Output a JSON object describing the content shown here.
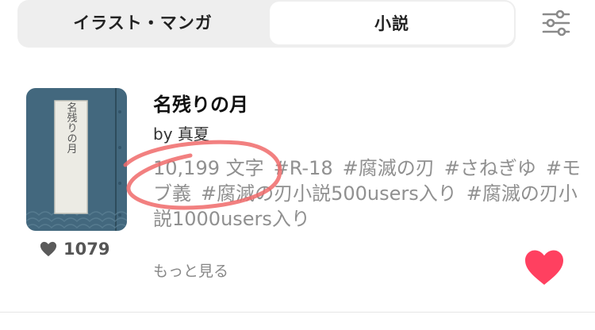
{
  "tabs": [
    {
      "label": "イラスト・マンガ",
      "selected": false
    },
    {
      "label": "小説",
      "selected": true
    }
  ],
  "filter_icon": "sliders-icon",
  "novel": {
    "cover_text": "名残りの月",
    "title": "名残りの月",
    "author": "by 真夏",
    "word_count": "10,199 文字",
    "tags": [
      "#R-18",
      "#腐滅の刃",
      "#さねぎゆ",
      "#モブ義",
      "#腐滅の刃小説500users入り",
      "#腐滅の刃小説1000users入り"
    ],
    "like_count": "1079",
    "more_label": "もっと見る"
  },
  "colors": {
    "heart_active": "#ff4060",
    "annotation": "#f06a6a",
    "cover_bg": "#3f6478"
  }
}
